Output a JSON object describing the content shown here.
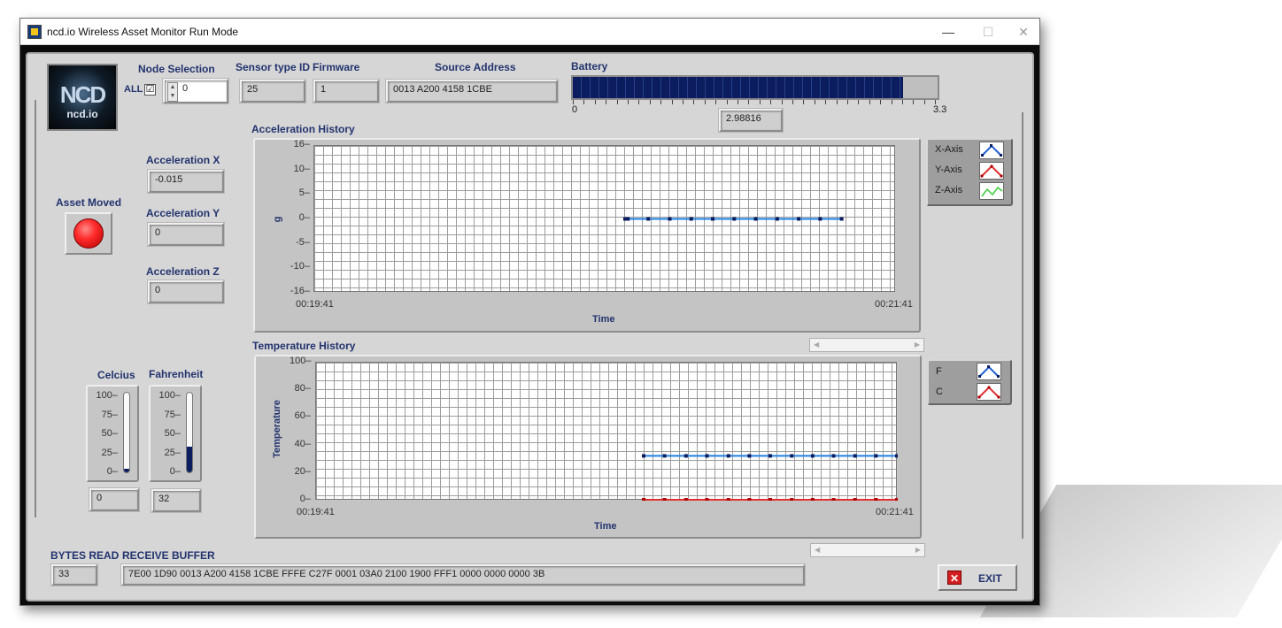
{
  "window": {
    "title": "ncd.io Wireless Asset Monitor Run Mode",
    "controls": {
      "minimize": "—",
      "maximize": "☐",
      "close": "✕"
    }
  },
  "logo": {
    "mark": "NCD",
    "text": "ncd.io"
  },
  "node_selection": {
    "label": "Node Selection",
    "all_label": "ALL",
    "all_checked": "☑",
    "value": "0"
  },
  "sensor_type": {
    "label": "Sensor type ID",
    "value": "25"
  },
  "firmware": {
    "label": "Firmware",
    "value": "1"
  },
  "source_address": {
    "label": "Source Address",
    "value": "0013 A200 4158 1CBE"
  },
  "battery": {
    "label": "Battery",
    "min": "0",
    "max": "3.3",
    "value": "2.98816",
    "level_fraction": 0.906
  },
  "acceleration": {
    "x_label": "Acceleration X",
    "x_value": "-0.015",
    "y_label": "Acceleration Y",
    "y_value": "0",
    "z_label": "Acceleration Z",
    "z_value": "0"
  },
  "asset_moved": {
    "label": "Asset Moved",
    "state": "on",
    "color": "#ff2b2b"
  },
  "celcius": {
    "label": "Celcius",
    "value": "0",
    "scale": [
      "100",
      "75",
      "50",
      "25",
      "0"
    ],
    "level_fraction": 0.0
  },
  "fahrenheit": {
    "label": "Fahrenheit",
    "value": "32",
    "scale": [
      "100",
      "75",
      "50",
      "25",
      "0"
    ],
    "level_fraction": 0.32
  },
  "bytes_read": {
    "label": "BYTES READ",
    "value": "33"
  },
  "receive_buffer": {
    "label": "RECEIVE BUFFER",
    "value": "7E00 1D90 0013 A200 4158 1CBE FFFE C27F 0001 03A0 2100 1900 FFF1 0000 0000 0000 3B"
  },
  "exit_button": {
    "label": "EXIT",
    "icon": "close-icon"
  },
  "chart_data": [
    {
      "type": "line",
      "title": "Acceleration History",
      "xlabel": "Time",
      "ylabel": "g",
      "x_range": [
        "00:19:41",
        "00:21:41"
      ],
      "y_ticks": [
        "16",
        "10",
        "5",
        "0",
        "-5",
        "-10",
        "-16"
      ],
      "ylim": [
        -16,
        16
      ],
      "grid": true,
      "legend_position": "right",
      "series": [
        {
          "name": "X-Axis",
          "color": "#1f7fe0",
          "x_fraction": [
            0.535,
            0.54,
            0.575,
            0.612,
            0.649,
            0.686,
            0.723,
            0.76,
            0.797,
            0.834,
            0.871,
            0.908
          ],
          "values": [
            0,
            0,
            0,
            0,
            0,
            0,
            0,
            0,
            0,
            0,
            0,
            0
          ]
        },
        {
          "name": "Y-Axis",
          "color": "#e03030",
          "values": []
        },
        {
          "name": "Z-Axis",
          "color": "#3ccc3c",
          "values": []
        }
      ]
    },
    {
      "type": "line",
      "title": "Temperature History",
      "xlabel": "Time",
      "ylabel": "Temperature",
      "x_range": [
        "00:19:41",
        "00:21:41"
      ],
      "y_ticks": [
        "100",
        "80",
        "60",
        "40",
        "20",
        "0"
      ],
      "ylim": [
        0,
        100
      ],
      "grid": true,
      "legend_position": "right",
      "series": [
        {
          "name": "F",
          "color": "#1f7fe0",
          "x_fraction": [
            0.564,
            0.6,
            0.637,
            0.673,
            0.71,
            0.746,
            0.782,
            0.819,
            0.855,
            0.891,
            0.928,
            0.964,
            1.0
          ],
          "values": [
            32,
            32,
            32,
            32,
            32,
            32,
            32,
            32,
            32,
            32,
            32,
            32,
            32
          ]
        },
        {
          "name": "C",
          "color": "#e03030",
          "x_fraction": [
            0.564,
            0.6,
            0.637,
            0.673,
            0.71,
            0.746,
            0.782,
            0.819,
            0.855,
            0.891,
            0.928,
            0.964,
            1.0
          ],
          "values": [
            0,
            0,
            0,
            0,
            0,
            0,
            0,
            0,
            0,
            0,
            0,
            0,
            0
          ]
        }
      ]
    }
  ]
}
